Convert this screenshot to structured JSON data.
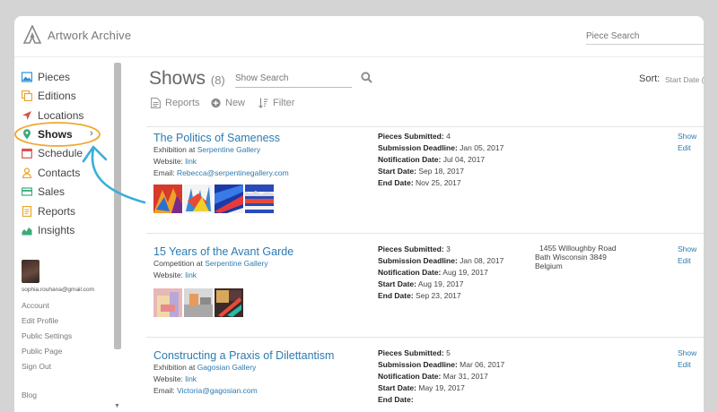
{
  "app": {
    "title": "Artwork Archive",
    "search_placeholder": "Piece Search"
  },
  "sidebar": {
    "items": [
      {
        "label": "Pieces",
        "icon": "image-icon",
        "color": "#2a8fd8"
      },
      {
        "label": "Editions",
        "icon": "editions-icon",
        "color": "#e8a52a"
      },
      {
        "label": "Locations",
        "icon": "location-arrow-icon",
        "color": "#d9534f"
      },
      {
        "label": "Shows",
        "icon": "map-pin-icon",
        "color": "#3aaa7a"
      },
      {
        "label": "Schedule",
        "icon": "calendar-icon",
        "color": "#d9534f"
      },
      {
        "label": "Contacts",
        "icon": "person-icon",
        "color": "#e8a52a"
      },
      {
        "label": "Sales",
        "icon": "card-icon",
        "color": "#3aaa7a"
      },
      {
        "label": "Reports",
        "icon": "report-icon",
        "color": "#e8a52a"
      },
      {
        "label": "Insights",
        "icon": "insights-chart-icon",
        "color": "#3aaa7a"
      }
    ],
    "user_email": "sophia.rouhana@gmail.com",
    "account_links": [
      "Account",
      "Edit Profile",
      "Public Settings",
      "Public Page",
      "Sign Out",
      "Blog"
    ]
  },
  "main": {
    "title": "Shows",
    "count": "(8)",
    "search_placeholder": "Show Search",
    "sort_label": "Sort:",
    "sort_value": "Start Date (",
    "toolbar": {
      "reports": "Reports",
      "new": "New",
      "filter": "Filter"
    },
    "field_labels": {
      "pieces": "Pieces Submitted:",
      "deadline": "Submission Deadline:",
      "notification": "Notification Date:",
      "start": "Start Date:",
      "end": "End Date:",
      "website": "Website:",
      "email": "Email:"
    },
    "shows": [
      {
        "title": "The Politics of Sameness",
        "type_prefix": "Exhibition at",
        "venue": "Serpentine Gallery",
        "website": "link",
        "email": "Rebecca@serpentinegallery.com",
        "pieces_submitted": "4",
        "submission_deadline": "Jan 05, 2017",
        "notification_date": "Jul 04, 2017",
        "start_date": "Sep 18, 2017",
        "end_date": "Nov 25, 2017",
        "address": [],
        "actions": [
          "Show",
          "Edit"
        ]
      },
      {
        "title": "15 Years of the Avant Garde",
        "type_prefix": "Competition at",
        "venue": "Serpentine Gallery",
        "website": "link",
        "email": "",
        "pieces_submitted": "3",
        "submission_deadline": "Jan 08, 2017",
        "notification_date": "Aug 19, 2017",
        "start_date": "Aug 19, 2017",
        "end_date": "Sep 23, 2017",
        "address": [
          "1455 Willoughby Road",
          "Bath Wisconsin 3849",
          "Belgium"
        ],
        "actions": [
          "Show",
          "Edit"
        ]
      },
      {
        "title": "Constructing a Praxis of Dilettantism",
        "type_prefix": "Exhibition at",
        "venue": "Gagosian Gallery",
        "website": "link",
        "email": "Victoria@gagosian.com",
        "pieces_submitted": "5",
        "submission_deadline": "Mar 06, 2017",
        "notification_date": "Mar 31, 2017",
        "start_date": "May 19, 2017",
        "end_date": "",
        "address": [],
        "actions": [
          "Show",
          "Edit"
        ]
      }
    ]
  },
  "colors": {
    "link": "#2c7bb2",
    "annotation": "#f0a830",
    "arrow": "#3aafd6"
  }
}
